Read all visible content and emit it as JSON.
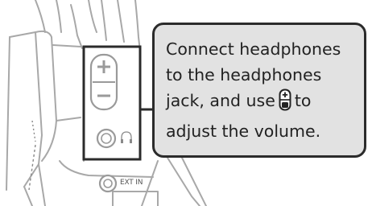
{
  "callout": {
    "line1": "Connect headphones",
    "line2": "to the headphones",
    "line3_before": "jack, and use",
    "line3_icon": "volume-rocker-icon",
    "line3_after": "to",
    "line4": "adjust the volume."
  },
  "labels": {
    "ext_in": "EXT IN"
  },
  "icons": {
    "headphones_symbol": "headphones-icon",
    "volume_plus": "+",
    "volume_minus": "−"
  },
  "colors": {
    "callout_fill": "#e2e2e2",
    "callout_border": "#2b2b2b",
    "line_art": "#a8a8a8",
    "highlight_box": "#2b2b2b"
  }
}
